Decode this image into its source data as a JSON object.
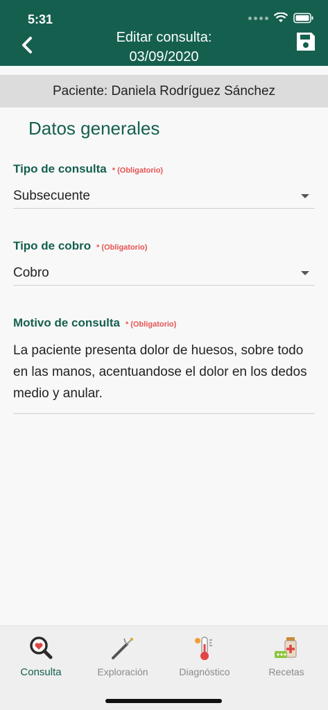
{
  "status": {
    "time": "5:31"
  },
  "header": {
    "title_line1": "Editar consulta:",
    "title_line2": "03/09/2020"
  },
  "patient": {
    "label": "Paciente: Daniela Rodríguez Sánchez"
  },
  "section": {
    "title": "Datos generales"
  },
  "form": {
    "required_note": "* (Obligatorio)",
    "tipo_consulta": {
      "label": "Tipo de consulta",
      "value": "Subsecuente"
    },
    "tipo_cobro": {
      "label": "Tipo de cobro",
      "value": "Cobro"
    },
    "motivo": {
      "label": "Motivo de consulta",
      "value": "La paciente presenta dolor de huesos, sobre todo en las manos, acentuandose el dolor en los dedos medio y anular."
    }
  },
  "tabs": [
    {
      "label": "Consulta",
      "icon": "magnifier-heart-icon",
      "active": true
    },
    {
      "label": "Exploración",
      "icon": "probe-icon",
      "active": false
    },
    {
      "label": "Diagnóstico",
      "icon": "thermometer-icon",
      "active": false
    },
    {
      "label": "Recetas",
      "icon": "medicine-icon",
      "active": false
    }
  ],
  "colors": {
    "primary": "#155f4f",
    "required": "#e55353"
  }
}
